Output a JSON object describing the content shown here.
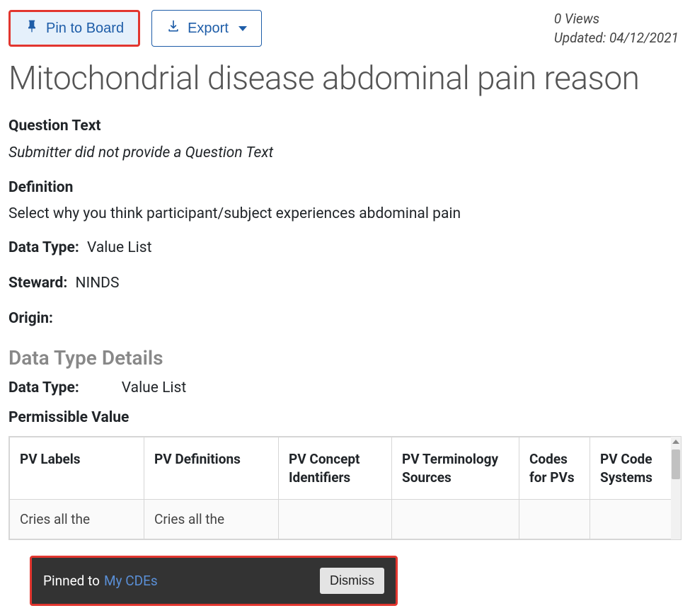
{
  "toolbar": {
    "pin_label": "Pin to Board",
    "export_label": "Export"
  },
  "meta": {
    "views": "0 Views",
    "updated": "Updated: 04/12/2021"
  },
  "title": "Mitochondrial disease abdominal pain reason",
  "question_text": {
    "label": "Question Text",
    "value": "Submitter did not provide a Question Text"
  },
  "definition": {
    "label": "Definition",
    "value": "Select why you think participant/subject experiences abdominal pain"
  },
  "data_type": {
    "label": "Data Type:",
    "value": "Value List"
  },
  "steward": {
    "label": "Steward:",
    "value": "NINDS"
  },
  "origin": {
    "label": "Origin:"
  },
  "details": {
    "title": "Data Type Details",
    "data_type_label": "Data Type:",
    "data_type_value": "Value List",
    "permissible_label": "Permissible Value"
  },
  "table": {
    "headers": [
      "PV Labels",
      "PV Definitions",
      "PV Concept Identifiers",
      "PV Terminology Sources",
      "Codes for PVs",
      "PV Code Systems"
    ],
    "row0": {
      "c0": "Cries all the",
      "c1": "Cries all the"
    }
  },
  "toast": {
    "prefix": "Pinned to",
    "link": "My CDEs",
    "dismiss": "Dismiss"
  }
}
